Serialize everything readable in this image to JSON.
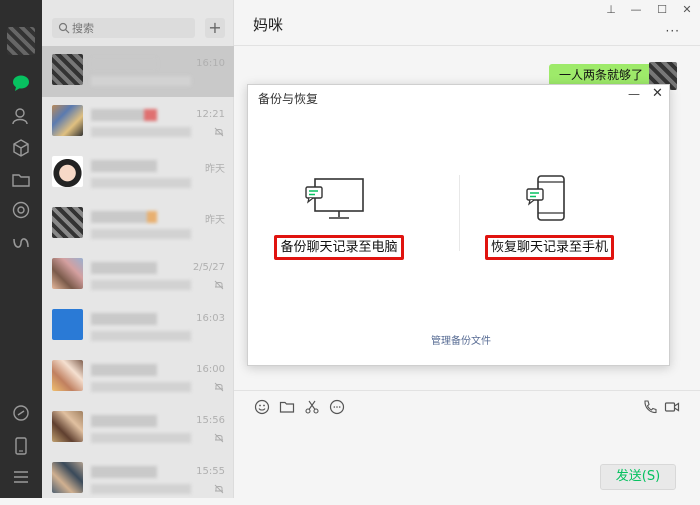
{
  "sidebar": {
    "icons": [
      "chat-icon",
      "contacts-icon",
      "favorites-icon",
      "folder-icon",
      "moments-icon",
      "mini-programs-icon",
      "link-icon",
      "phone-icon",
      "menu-icon"
    ]
  },
  "search": {
    "placeholder": "搜索"
  },
  "add_button": "+",
  "chats": [
    {
      "time": "16:10",
      "muted": false
    },
    {
      "time": "12:21",
      "muted": true
    },
    {
      "time": "昨天",
      "muted": false
    },
    {
      "time": "昨天",
      "muted": false
    },
    {
      "time": "2/5/27",
      "muted": true
    },
    {
      "time": "16:03",
      "muted": false
    },
    {
      "time": "16:00",
      "muted": true
    },
    {
      "time": "15:56",
      "muted": true
    },
    {
      "time": "15:55",
      "muted": true
    }
  ],
  "chat": {
    "title": "妈咪",
    "outgoing_message": "一人两条就够了",
    "send_label": "发送(S)"
  },
  "window_controls": {
    "pin": "⊥",
    "minimize": "—",
    "maximize": "☐",
    "close": "✕"
  },
  "modal": {
    "title": "备份与恢复",
    "minimize": "—",
    "close": "✕",
    "backup_to_pc": "备份聊天记录至电脑",
    "restore_to_phone": "恢复聊天记录至手机",
    "manage_link": "管理备份文件"
  },
  "colors": {
    "accent": "#07c160",
    "highlight_border": "#e0130f",
    "bubble": "#9eea6a",
    "sidebar": "#2e2e2e"
  }
}
